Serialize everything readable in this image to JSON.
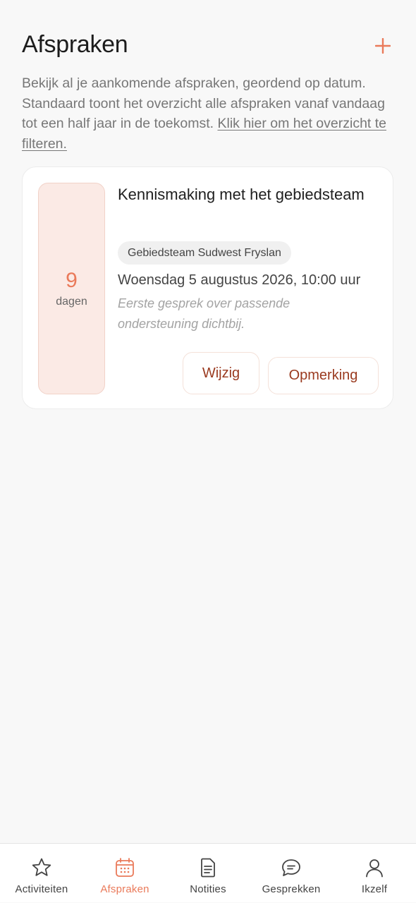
{
  "header": {
    "title": "Afspraken",
    "add_icon": "plus-icon"
  },
  "intro": {
    "text": "Bekijk al je aankomende afspraken, geordend op datum. Standaard toont het overzicht alle afspraken vanaf vandaag tot een half jaar in de toekomst. ",
    "filter_link": "Klik hier om het overzicht te filteren."
  },
  "appointment": {
    "days_value": "9",
    "days_unit": "dagen",
    "title": "Kennismaking met het gebiedsteam",
    "team": "Gebiedsteam Sudwest Fryslan",
    "datetime": "Woensdag 5 augustus 2026, 10:00 uur",
    "note": "Eerste gesprek over passende ondersteuning dichtbij.",
    "edit_label": "Wijzig",
    "remark_label": "Opmerking"
  },
  "nav": {
    "items": [
      {
        "label": "Activiteiten",
        "icon": "star-icon",
        "active": false
      },
      {
        "label": "Afspraken",
        "icon": "calendar-icon",
        "active": true
      },
      {
        "label": "Notities",
        "icon": "document-icon",
        "active": false
      },
      {
        "label": "Gesprekken",
        "icon": "chat-icon",
        "active": false
      },
      {
        "label": "Ikzelf",
        "icon": "user-icon",
        "active": false
      }
    ]
  },
  "colors": {
    "accent": "#ea7a5a",
    "days_box_bg": "#fbeae5",
    "button_text": "#9a3a1f",
    "background": "#f8f8f8"
  }
}
